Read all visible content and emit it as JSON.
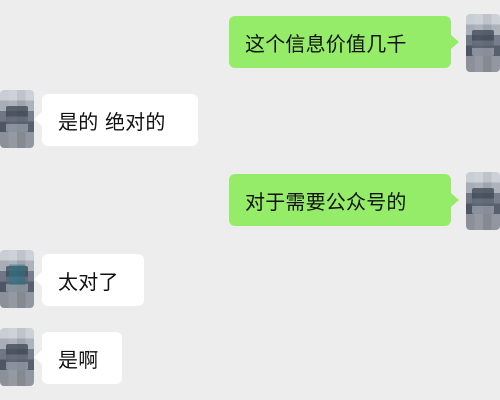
{
  "chat": {
    "messages": [
      {
        "side": "right",
        "text": "这个信息价值几千"
      },
      {
        "side": "left",
        "text": "是的 绝对的"
      },
      {
        "side": "right",
        "text": "对于需要公众号的"
      },
      {
        "side": "left",
        "text": "太对了"
      },
      {
        "side": "left",
        "text": "是啊"
      }
    ]
  },
  "colors": {
    "background": "#ededed",
    "outgoing_bubble": "#95ec69",
    "incoming_bubble": "#ffffff",
    "text": "#111111"
  },
  "icons": {
    "outgoing_avatar": "avatar-icon",
    "incoming_avatar": "avatar-icon"
  }
}
